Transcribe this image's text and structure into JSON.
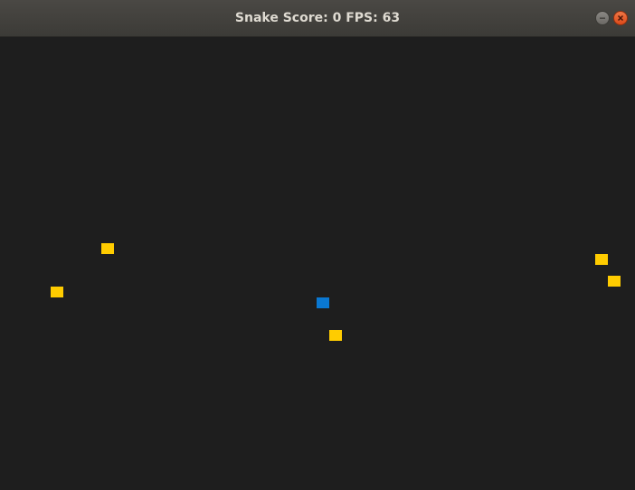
{
  "window": {
    "title": "Snake Score: 0 FPS: 63",
    "controls": [
      {
        "name": "minimize-button",
        "icon": "minimize-icon"
      },
      {
        "name": "close-button",
        "icon": "close-icon"
      }
    ]
  },
  "game": {
    "score": 0,
    "fps": 63,
    "colors": {
      "background": "#1e1e1e",
      "snake": "#0a78d2",
      "food": "#ffcc00"
    }
  }
}
